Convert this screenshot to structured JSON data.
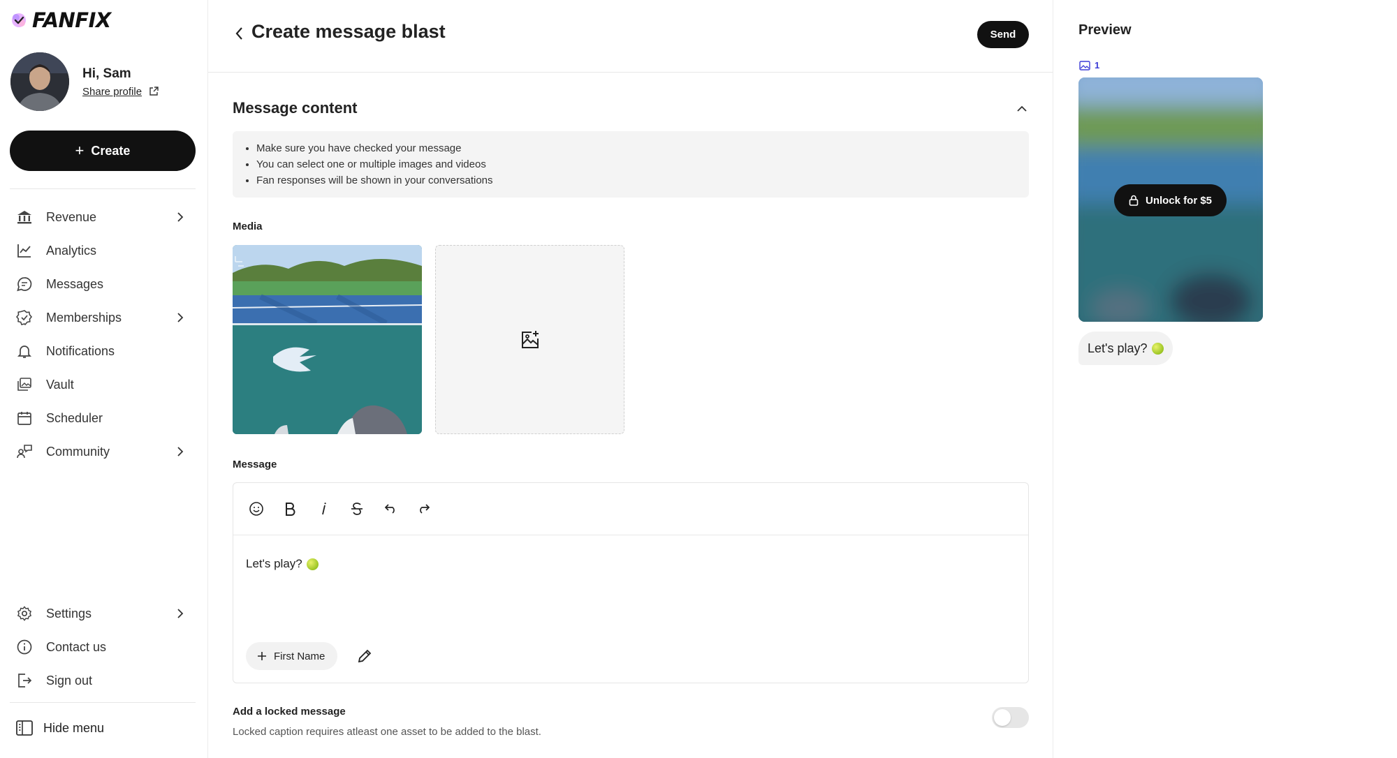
{
  "brand": {
    "name": "FANFIX"
  },
  "profile": {
    "greeting": "Hi, Sam",
    "share_label": "Share profile"
  },
  "sidebar": {
    "create_label": "Create",
    "items": [
      {
        "label": "Revenue",
        "icon": "bank-icon",
        "has_chevron": true
      },
      {
        "label": "Analytics",
        "icon": "chart-line-icon",
        "has_chevron": false
      },
      {
        "label": "Messages",
        "icon": "chat-bubble-icon",
        "has_chevron": false
      },
      {
        "label": "Memberships",
        "icon": "badge-check-icon",
        "has_chevron": true
      },
      {
        "label": "Notifications",
        "icon": "bell-icon",
        "has_chevron": false
      },
      {
        "label": "Vault",
        "icon": "images-icon",
        "has_chevron": false
      },
      {
        "label": "Scheduler",
        "icon": "calendar-icon",
        "has_chevron": false
      },
      {
        "label": "Community",
        "icon": "people-chat-icon",
        "has_chevron": true
      }
    ],
    "bottom_items": [
      {
        "label": "Settings",
        "icon": "gear-icon",
        "has_chevron": true
      },
      {
        "label": "Contact us",
        "icon": "info-icon",
        "has_chevron": false
      },
      {
        "label": "Sign out",
        "icon": "sign-out-icon",
        "has_chevron": false
      }
    ],
    "hide_menu_label": "Hide menu"
  },
  "main": {
    "title": "Create message blast",
    "send_label": "Send",
    "section_title": "Message content",
    "notes": [
      "Make sure you have checked your message",
      "You can select one or multiple images and videos",
      "Fan responses will be shown in your conversations"
    ],
    "media_label": "Media",
    "message_label": "Message",
    "message_text": "Let's play?",
    "chip_label": "First Name",
    "locked_title": "Add a locked message",
    "locked_desc": "Locked caption requires atleast one asset to be added to the blast.",
    "locked_enabled": false
  },
  "preview": {
    "title": "Preview",
    "media_count": "1",
    "unlock_label": "Unlock for $5",
    "bubble_text": "Let's play?"
  },
  "colors": {
    "accent": "#111111",
    "count_blue": "#3b3bd6",
    "surface": "#f4f4f4"
  }
}
